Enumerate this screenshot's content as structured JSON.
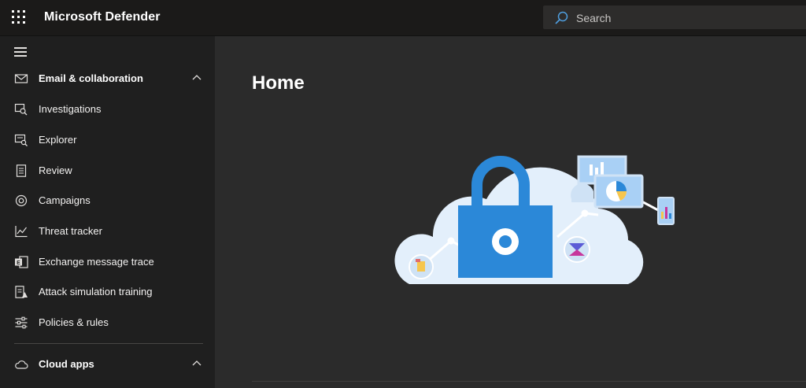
{
  "app": {
    "title": "Microsoft Defender"
  },
  "search": {
    "placeholder": "Search"
  },
  "sidebar": {
    "sections": [
      {
        "label": "Email & collaboration",
        "expanded": true
      },
      {
        "label": "Cloud apps",
        "expanded": true
      }
    ],
    "items": [
      {
        "label": "Investigations",
        "icon": "investigations-icon"
      },
      {
        "label": "Explorer",
        "icon": "explorer-icon"
      },
      {
        "label": "Review",
        "icon": "review-icon"
      },
      {
        "label": "Campaigns",
        "icon": "campaigns-icon"
      },
      {
        "label": "Threat tracker",
        "icon": "threat-tracker-icon"
      },
      {
        "label": "Exchange message trace",
        "icon": "exchange-icon"
      },
      {
        "label": "Attack simulation training",
        "icon": "attack-simulation-icon"
      },
      {
        "label": "Policies & rules",
        "icon": "policies-icon"
      }
    ]
  },
  "main": {
    "title": "Home"
  },
  "colors": {
    "topbar": "#1b1a19",
    "sidebar": "#1f1f1f",
    "content": "#2b2b2b",
    "accent": "#0f78d4"
  }
}
